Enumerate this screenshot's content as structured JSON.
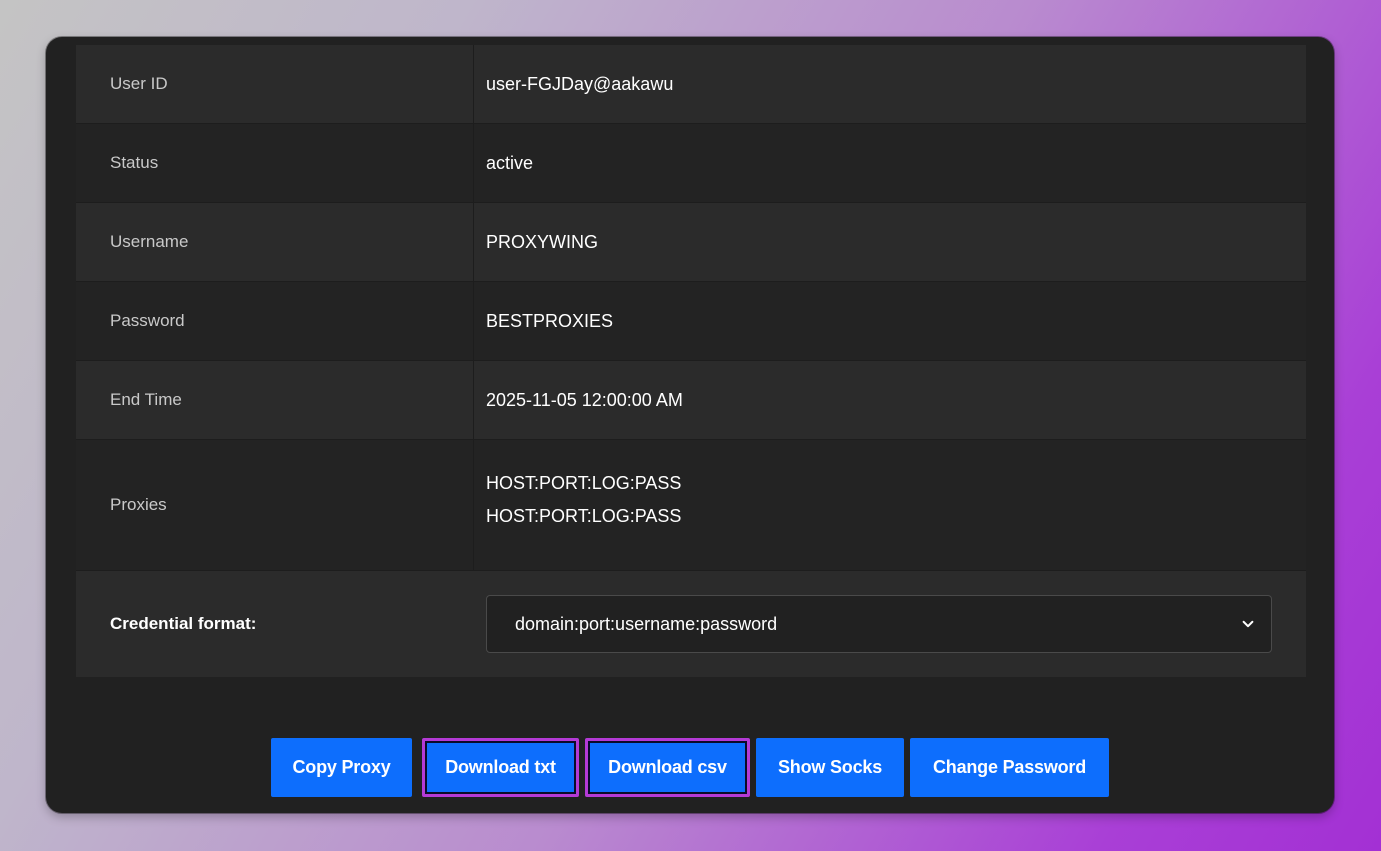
{
  "details": [
    {
      "label": "User ID",
      "value": "user-FGJDay@aakawu"
    },
    {
      "label": "Status",
      "value": "active"
    },
    {
      "label": "Username",
      "value": "PROXYWING"
    },
    {
      "label": "Password",
      "value": "BESTPROXIES"
    },
    {
      "label": "End Time",
      "value": "2025-11-05 12:00:00 AM"
    }
  ],
  "proxies": {
    "label": "Proxies",
    "lines": [
      "HOST:PORT:LOG:PASS",
      "HOST:PORT:LOG:PASS"
    ]
  },
  "credential_format": {
    "label": "Credential format:",
    "selected": "domain:port:username:password"
  },
  "buttons": {
    "copy_proxy": "Copy Proxy",
    "download_txt": "Download txt",
    "download_csv": "Download csv",
    "show_socks": "Show Socks",
    "change_password": "Change Password"
  },
  "colors": {
    "button_blue": "#0d6efd",
    "highlight_border": "#b43ad6",
    "panel_bg": "#212121"
  },
  "icons": {
    "select_caret": "chevron-down-icon"
  }
}
